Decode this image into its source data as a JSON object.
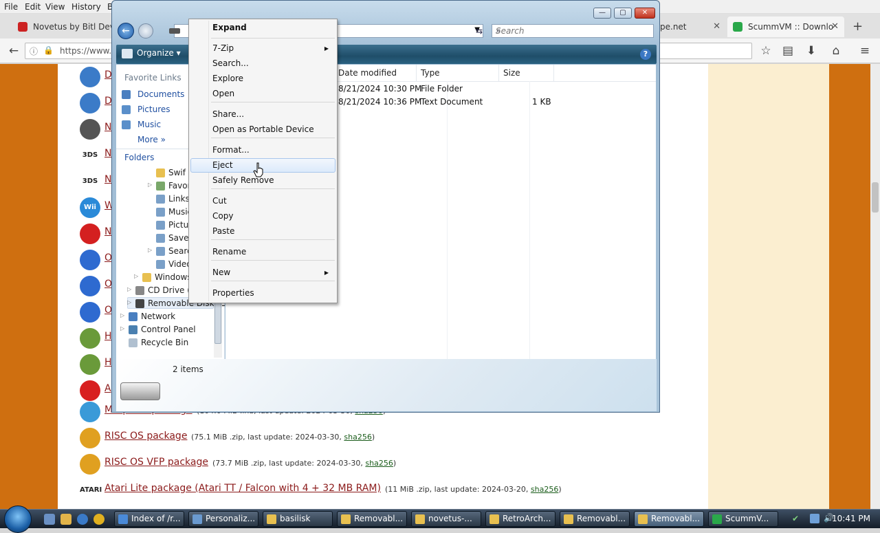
{
  "browser": {
    "menu": [
      "File",
      "Edit",
      "View",
      "History",
      "B"
    ],
    "tabs": [
      {
        "label": "Novetus by Bitl Deve",
        "close": "✕"
      },
      {
        "label": "pe.net",
        "close": "✕"
      },
      {
        "label": "ScummVM :: Downlo",
        "close": "✕"
      }
    ],
    "new_tab": "+",
    "url": "https://www.s"
  },
  "page": {
    "rows": [
      {
        "link": "D",
        "meta": ""
      },
      {
        "link": "D",
        "meta": ""
      },
      {
        "link": "N",
        "meta": ""
      },
      {
        "link": "N",
        "meta": "",
        "badge": "3DS"
      },
      {
        "link": "N",
        "meta": "",
        "badge": "3DS"
      },
      {
        "link": "W",
        "meta": "",
        "badge": "Wii"
      },
      {
        "link": "N",
        "meta": ""
      },
      {
        "link": "O",
        "meta": ""
      },
      {
        "link": "O",
        "meta": ""
      },
      {
        "link": "O",
        "meta": ""
      },
      {
        "link": "H",
        "meta": ""
      },
      {
        "link": "H",
        "meta": ""
      },
      {
        "link": "A",
        "meta": ""
      },
      {
        "link": "MorphOS package",
        "meta": "(104.0 MiB .lha, last update: 2024-03-30,",
        "hash": "sha256",
        "tail": ")"
      },
      {
        "link": "RISC OS package",
        "meta": "(75.1 MiB .zip, last update: 2024-03-30,",
        "hash": "sha256",
        "tail": ")"
      },
      {
        "link": "RISC OS VFP package",
        "meta": "(73.7 MiB .zip, last update: 2024-03-30,",
        "hash": "sha256",
        "tail": ")"
      },
      {
        "link": "Atari Lite package (Atari TT / Falcon with 4 + 32 MB RAM)",
        "meta": "(11 MiB .zip, last update: 2024-03-20,",
        "hash": "sha256",
        "tail": ")",
        "badge": "ATARI"
      }
    ]
  },
  "explorer": {
    "caption": {
      "min": "—",
      "max": "▢",
      "close": "✕"
    },
    "search_placeholder": "Search",
    "toolbar": {
      "organize": "Organize",
      "help": "?"
    },
    "nav": {
      "favorites_header": "Favorite Links",
      "favorites": [
        "Documents",
        "Pictures",
        "Music",
        "More"
      ],
      "folders_header": "Folders",
      "tree": [
        "Swif",
        "Favorit",
        "Links",
        "Music",
        "Pictur",
        "Saved",
        "Search",
        "Videos",
        "Windows",
        "CD Drive (D:",
        "Removable Disk (E:",
        "Network",
        "Control Panel",
        "Recycle Bin"
      ]
    },
    "columns": [
      "Date modified",
      "Type",
      "Size"
    ],
    "files": [
      {
        "date": "8/21/2024 10:30 PM",
        "type": "File Folder",
        "size": ""
      },
      {
        "date": "8/21/2024 10:36 PM",
        "type": "Text Document",
        "size": "1 KB"
      }
    ],
    "status": "2 items"
  },
  "context_menu": {
    "items": [
      {
        "label": "Expand",
        "bold": true
      },
      {
        "label": "7-Zip",
        "sub": true
      },
      {
        "label": "Search..."
      },
      {
        "label": "Explore"
      },
      {
        "label": "Open"
      },
      {
        "label": "Share..."
      },
      {
        "label": "Open as Portable Device"
      },
      {
        "label": "Format..."
      },
      {
        "label": "Eject",
        "highlighted": true
      },
      {
        "label": "Safely Remove"
      },
      {
        "label": "Cut"
      },
      {
        "label": "Copy"
      },
      {
        "label": "Paste"
      },
      {
        "label": "Rename"
      },
      {
        "label": "New",
        "sub": true
      },
      {
        "label": "Properties"
      }
    ]
  },
  "taskbar": {
    "items": [
      "Index of /r...",
      "Personaliz...",
      "basilisk",
      "Removabl...",
      "novetus-...",
      "RetroArch...",
      "Removabl...",
      "Removabl...",
      "ScummV..."
    ],
    "active_index": 7,
    "clock": "10:41 PM"
  },
  "colors": {
    "page_bg": "#cf6f10",
    "sidebar_bg": "#fbeed0",
    "link": "#8b1a1a",
    "explorer_toolbar": "#1f4e69"
  }
}
